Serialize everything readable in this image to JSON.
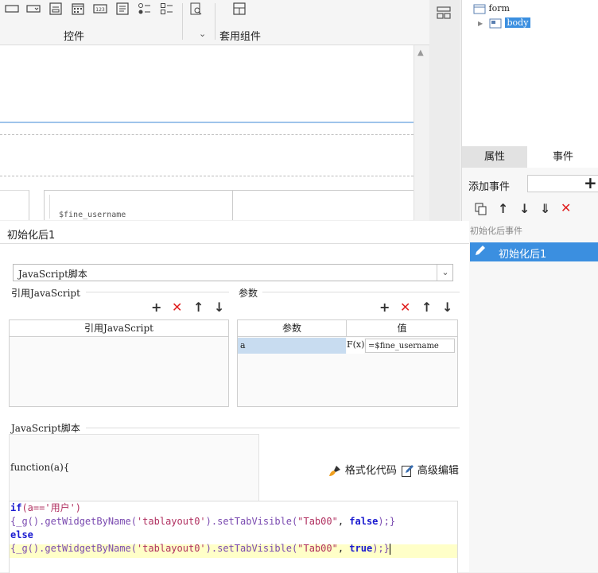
{
  "toolbar": {
    "controls_label": "控件",
    "components_label": "套用组件"
  },
  "canvas": {
    "field_text": "$fine_username"
  },
  "tree": {
    "root_label": "form",
    "child_label": "body"
  },
  "side_panel": {
    "tabs": [
      "属性",
      "事件"
    ],
    "add_event_label": "添加事件",
    "event_group_label": "初始化后事件",
    "event_item_label": "初始化后1"
  },
  "dialog": {
    "title": "初始化后1",
    "script_type": "JavaScript脚本",
    "ref_js_label": "引用JavaScript",
    "params_label": "参数",
    "ref_js_header": "引用JavaScript",
    "params_header_name": "参数",
    "params_header_value": "值",
    "param_row": {
      "name": "a",
      "formula_icon": "F(x)",
      "value": "=$fine_username"
    },
    "script_label": "JavaScript脚本",
    "function_signature": "function(a){",
    "format_code_label": "格式化代码",
    "advanced_edit_label": "高级编辑",
    "code": {
      "line1_kw": "if",
      "line1_rest": "(a=='用户')",
      "line2_pre": "{_g().getWidgetByName(",
      "line2_name": "'tablayout0'",
      "line2_mid": ").setTabVisible(",
      "line2_str": "\"Tab00\"",
      "line2_sep": ", ",
      "line2_bool": "false",
      "line2_end": ");}",
      "line3_kw": "else",
      "line4_pre": "{_g().getWidgetByName(",
      "line4_name": "'tablayout0'",
      "line4_mid": ").setTabVisible(",
      "line4_str": "\"Tab00\"",
      "line4_sep": ", ",
      "line4_bool": "true",
      "line4_end": ");}"
    }
  },
  "colors": {
    "accent": "#3b8fe0",
    "selected_bg": "#c8dcf0",
    "highlight_line": "#ffffc8",
    "danger": "#e02020"
  }
}
